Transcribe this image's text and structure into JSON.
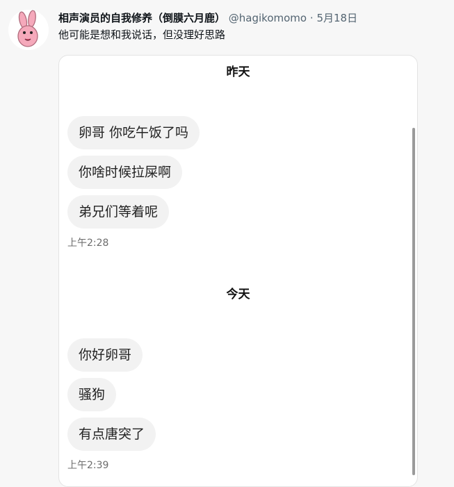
{
  "tweet": {
    "author_name": "相声演员的自我修养（倒膜六月鹿）",
    "handle": "@hagikomomo",
    "separator": "·",
    "date": "5月18日",
    "text": "他可能是想和我说话，但没理好思路",
    "avatar_icon": "pink-rabbit-avatar-icon"
  },
  "chat": {
    "sections": [
      {
        "day": "昨天",
        "messages": [
          "卵哥 你吃午饭了吗",
          "你啥时候拉屎啊",
          "弟兄们等着呢"
        ],
        "time": "上午2:28"
      },
      {
        "day": "今天",
        "messages": [
          "你好卵哥",
          "骚狗",
          "有点唐突了"
        ],
        "time": "上午2:39"
      }
    ]
  },
  "colors": {
    "page_bg": "#f7f7f7",
    "bubble_bg": "#f2f2f2",
    "muted_text": "#536471",
    "rabbit_pink": "#f5a9bb"
  }
}
